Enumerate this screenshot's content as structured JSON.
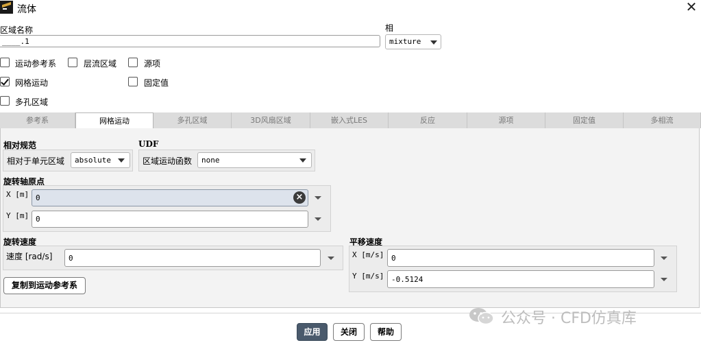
{
  "window": {
    "title": "流体",
    "close_glyph": "✕"
  },
  "zone": {
    "name_label": "区域名称",
    "name_value": "____.1",
    "phase_label": "相",
    "phase_value": "mixture"
  },
  "options": {
    "moving_reference_frame": {
      "label": "运动参考系",
      "checked": false
    },
    "laminar_zone": {
      "label": "层流区域",
      "checked": false
    },
    "source_terms": {
      "label": "源项",
      "checked": false
    },
    "mesh_motion": {
      "label": "网格运动",
      "checked": true
    },
    "fixed_values": {
      "label": "固定值",
      "checked": false
    },
    "porous_zone": {
      "label": "多孔区域",
      "checked": false
    }
  },
  "tabs": [
    {
      "label": "参考系",
      "active": false
    },
    {
      "label": "网格运动",
      "active": true
    },
    {
      "label": "多孔区域",
      "active": false
    },
    {
      "label": "3D风扇区域",
      "active": false
    },
    {
      "label": "嵌入式LES",
      "active": false
    },
    {
      "label": "反应",
      "active": false
    },
    {
      "label": "源项",
      "active": false
    },
    {
      "label": "固定值",
      "active": false
    },
    {
      "label": "多相流",
      "active": false
    }
  ],
  "relative_spec": {
    "title": "相对规范",
    "relative_to_label": "相对于单元区域",
    "relative_to_value": "absolute"
  },
  "udf": {
    "title": "UDF",
    "zone_motion_fn_label": "区域运动函数",
    "zone_motion_fn_value": "none"
  },
  "rotation_origin": {
    "title": "旋转轴原点",
    "x_label": "X [m]",
    "x_value": "0",
    "y_label": "Y [m]",
    "y_value": "0"
  },
  "rotation_velocity": {
    "title": "旋转速度",
    "speed_label": "速度 [rad/s]",
    "speed_value": "0"
  },
  "translational_velocity": {
    "title": "平移速度",
    "x_label": "X [m/s]",
    "x_value": "0",
    "y_label": "Y [m/s]",
    "y_value": "-0.5124"
  },
  "copy_button_label": "复制到运动参考系",
  "footer": {
    "apply_label": "应用",
    "close_label": "关闭",
    "help_label": "帮助"
  },
  "watermark": "公众号 · CFD仿真库",
  "colors": {
    "primary_button": "#4a5a6c",
    "focused_field": "#dde3ec",
    "panel_bg": "#f3f3f3"
  }
}
